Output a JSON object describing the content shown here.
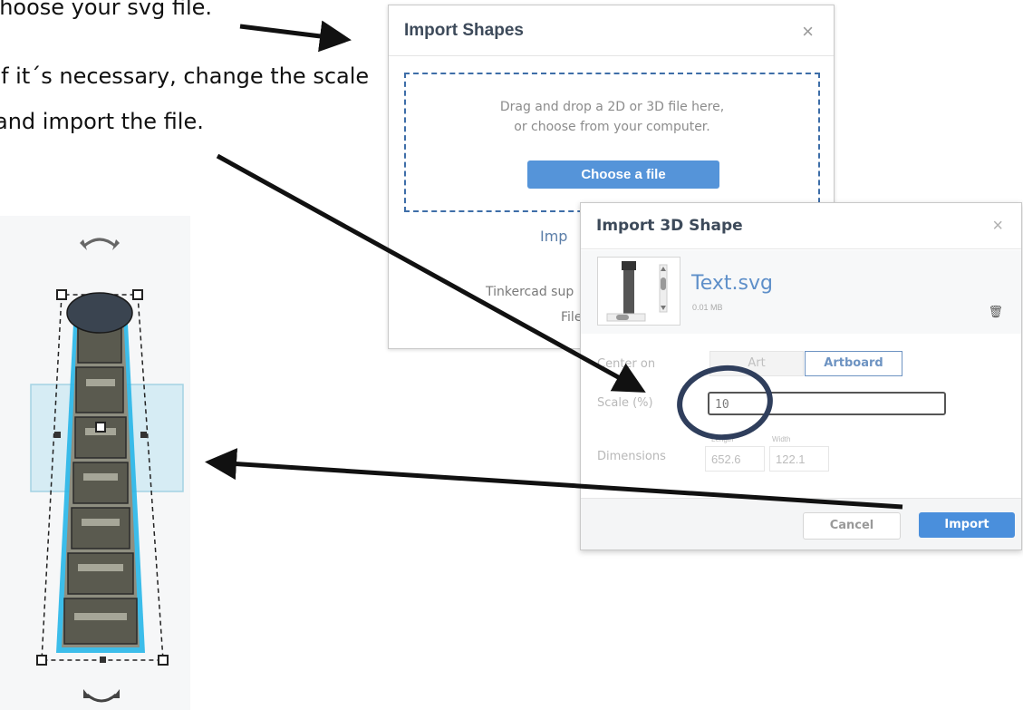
{
  "instructions": {
    "line1": "choose your svg file.",
    "line2": "If it´s necessary, change the scale",
    "line3": "and import the file."
  },
  "import_shapes": {
    "title": "Import Shapes",
    "close": "×",
    "drop_line1": "Drag and drop a 2D or 3D file here,",
    "drop_line2": "or choose from your computer.",
    "choose_button": "Choose a file",
    "import_partial": "Imp",
    "support_partial": "Tinkercad sup",
    "file_partial": "File s"
  },
  "import_3d": {
    "title": "Import 3D Shape",
    "close": "×",
    "file_name": "Text.svg",
    "file_size": "0.01 MB",
    "center_label": "Center on",
    "center_options": [
      "Art",
      "Artboard"
    ],
    "center_selected": "Artboard",
    "scale_label": "Scale (%)",
    "scale_value": "10",
    "dimensions_label": "Dimensions",
    "length_caption": "Length",
    "width_caption": "Width",
    "length_value": "652.6",
    "width_value": "122.1",
    "cancel_button": "Cancel",
    "import_button": "Import"
  },
  "colors": {
    "accent_blue": "#4a8fdc",
    "selection_cyan": "#28b6e8",
    "annotation": "#111111"
  },
  "icons": [
    "rotate-arrow-icon",
    "trash-icon",
    "close-icon"
  ]
}
